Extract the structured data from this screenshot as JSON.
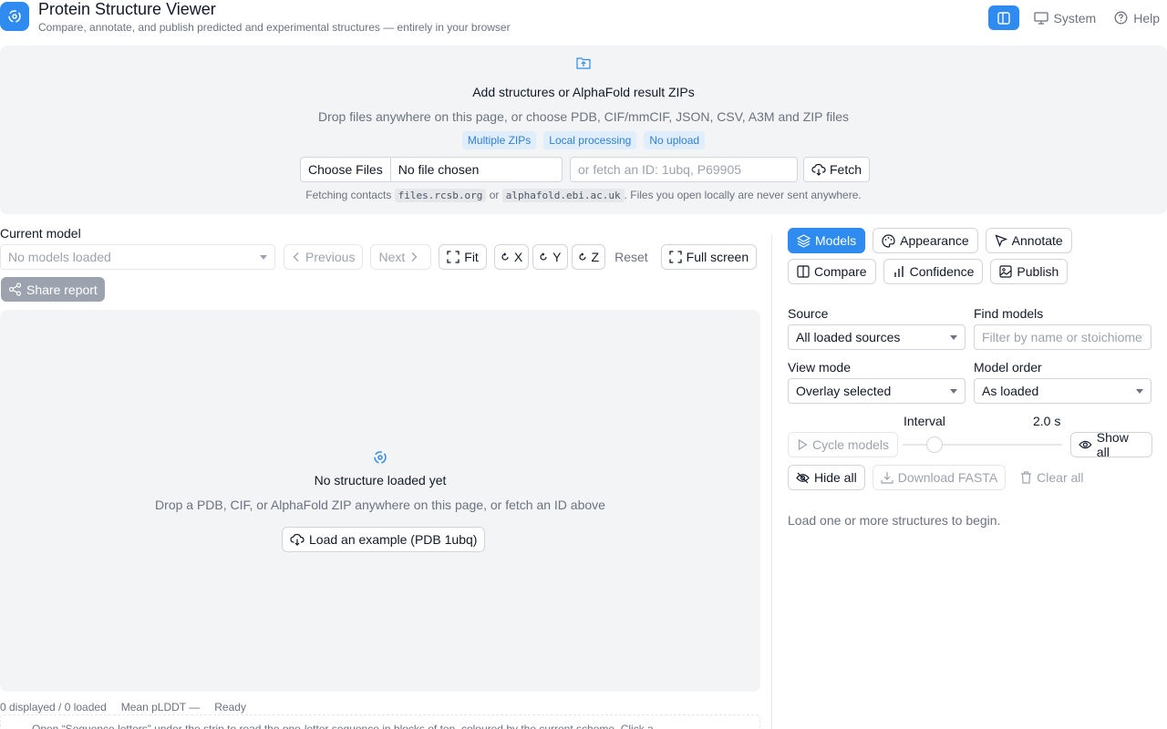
{
  "header": {
    "title": "Protein Structure Viewer",
    "subtitle": "Compare, annotate, and publish predicted and experimental structures — entirely in your browser",
    "system_label": "System",
    "help_label": "Help"
  },
  "dropzone": {
    "title": "Add structures or AlphaFold result ZIPs",
    "description": "Drop files anywhere on this page, or choose PDB, CIF/mmCIF, JSON, CSV, A3M and ZIP files",
    "tags": [
      "Multiple ZIPs",
      "Local processing",
      "No upload"
    ],
    "choose_files_label": "Choose Files",
    "file_status": "No file chosen",
    "fetch_placeholder": "or fetch an ID: 1ubq, P69905",
    "fetch_label": "Fetch",
    "note_prefix": "Fetching contacts",
    "note_host1": "files.rcsb.org",
    "note_or": "or",
    "note_host2": "alphafold.ebi.ac.uk",
    "note_suffix": ". Files you open locally are never sent anywhere."
  },
  "left": {
    "current_model_label": "Current model",
    "model_select_placeholder": "No models loaded",
    "previous_label": "Previous",
    "next_label": "Next",
    "fit_label": "Fit",
    "x_label": "X",
    "y_label": "Y",
    "z_label": "Z",
    "reset_label": "Reset",
    "fullscreen_label": "Full screen",
    "share_label": "Share report"
  },
  "viewer": {
    "empty_title": "No structure loaded yet",
    "empty_desc": "Drop a PDB, CIF, or AlphaFold ZIP anywhere on this page, or fetch an ID above",
    "example_label": "Load an example (PDB 1ubq)"
  },
  "status": {
    "counts": "0 displayed / 0 loaded",
    "mean_plddt": "Mean pLDDT —",
    "state": "Ready",
    "hint": "Open “Sequence letters” under the strip to read the one-letter sequence in blocks of ten, coloured by the current scheme. Click a"
  },
  "right": {
    "tabs": [
      "Models",
      "Appearance",
      "Annotate",
      "Compare",
      "Confidence",
      "Publish"
    ],
    "active_tab": "Models",
    "source_label": "Source",
    "source_value": "All loaded sources",
    "find_label": "Find models",
    "find_placeholder": "Filter by name or stoichiometry",
    "view_mode_label": "View mode",
    "view_mode_value": "Overlay selected",
    "model_order_label": "Model order",
    "model_order_value": "As loaded",
    "interval_label": "Interval",
    "interval_value": "2.0 s",
    "interval_fraction": 0.2,
    "cycle_label": "Cycle models",
    "show_all_label": "Show all",
    "hide_all_label": "Hide all",
    "download_fasta_label": "Download FASTA",
    "clear_all_label": "Clear all",
    "empty_message": "Load one or more structures to begin."
  },
  "colors": {
    "accent": "#2f8bf0",
    "tag_bg": "#e0eefc",
    "muted": "#6b7280"
  },
  "icons": [
    "app-logo-icon",
    "sidebar-panel-icon",
    "monitor-icon",
    "help-circle-icon",
    "folder-upload-icon",
    "cloud-download-icon",
    "chevron-left-icon",
    "chevron-right-icon",
    "fit-icon",
    "rotate-icon",
    "fullscreen-icon",
    "share-icon",
    "layers-icon",
    "palette-icon",
    "cursor-icon",
    "columns-icon",
    "bar-chart-icon",
    "image-icon",
    "play-icon",
    "eye-icon",
    "eye-off-icon",
    "download-icon",
    "trash-icon"
  ]
}
